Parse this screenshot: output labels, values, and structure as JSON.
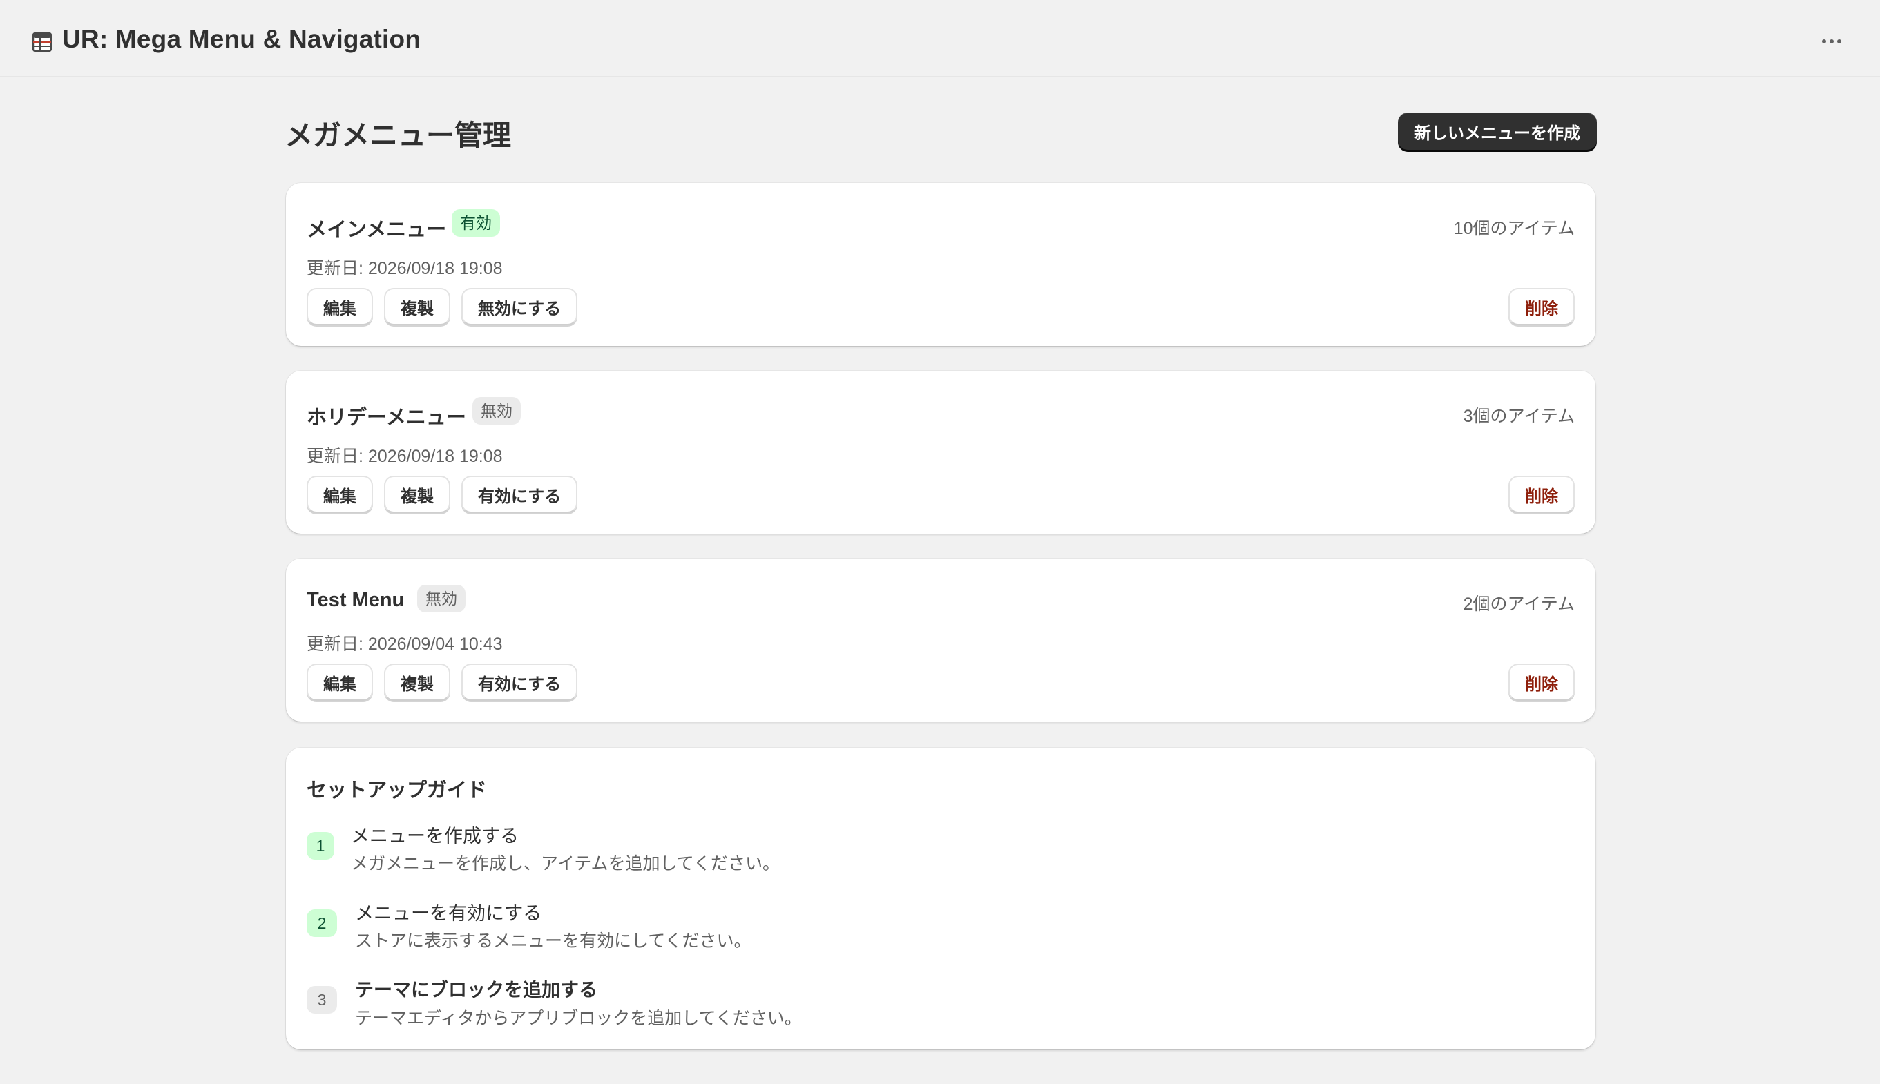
{
  "app": {
    "title": "UR: Mega Menu & Navigation",
    "icon": "app-table-icon"
  },
  "page": {
    "title": "メガメニュー管理",
    "create_button": "新しいメニューを作成"
  },
  "menus": [
    {
      "name": "メインメニュー",
      "status": "有効",
      "status_type": "active",
      "item_count": "10個のアイテム",
      "updated": "更新日: 2026/09/18 19:08",
      "actions": {
        "edit": "編集",
        "duplicate": "複製",
        "toggle": "無効にする",
        "delete": "削除"
      }
    },
    {
      "name": "ホリデーメニュー",
      "status": "無効",
      "status_type": "inactive",
      "item_count": "3個のアイテム",
      "updated": "更新日: 2026/09/18 19:08",
      "actions": {
        "edit": "編集",
        "duplicate": "複製",
        "toggle": "有効にする",
        "delete": "削除"
      }
    },
    {
      "name": "Test Menu",
      "status": "無効",
      "status_type": "inactive",
      "item_count": "2個のアイテム",
      "updated": "更新日: 2026/09/04 10:43",
      "actions": {
        "edit": "編集",
        "duplicate": "複製",
        "toggle": "有効にする",
        "delete": "削除"
      }
    }
  ],
  "guide": {
    "title": "セットアップガイド",
    "steps": [
      {
        "number": "1",
        "state": "done",
        "title": "メニューを作成する",
        "description": "メガメニューを作成し、アイテムを追加してください。"
      },
      {
        "number": "2",
        "state": "done",
        "title": "メニューを有効にする",
        "description": "ストアに表示するメニューを有効にしてください。"
      },
      {
        "number": "3",
        "state": "todo",
        "title": "テーマにブロックを追加する",
        "description": "テーマエディタからアプリブロックを追加してください。"
      }
    ]
  },
  "colors": {
    "background": "#f1f1f1",
    "card": "#ffffff",
    "primary_button": "#303030",
    "active_badge_bg": "#cdfed4",
    "active_badge_text": "#0c5132",
    "inactive_badge_bg": "#ebebeb",
    "critical_text": "#8e1f0b"
  }
}
